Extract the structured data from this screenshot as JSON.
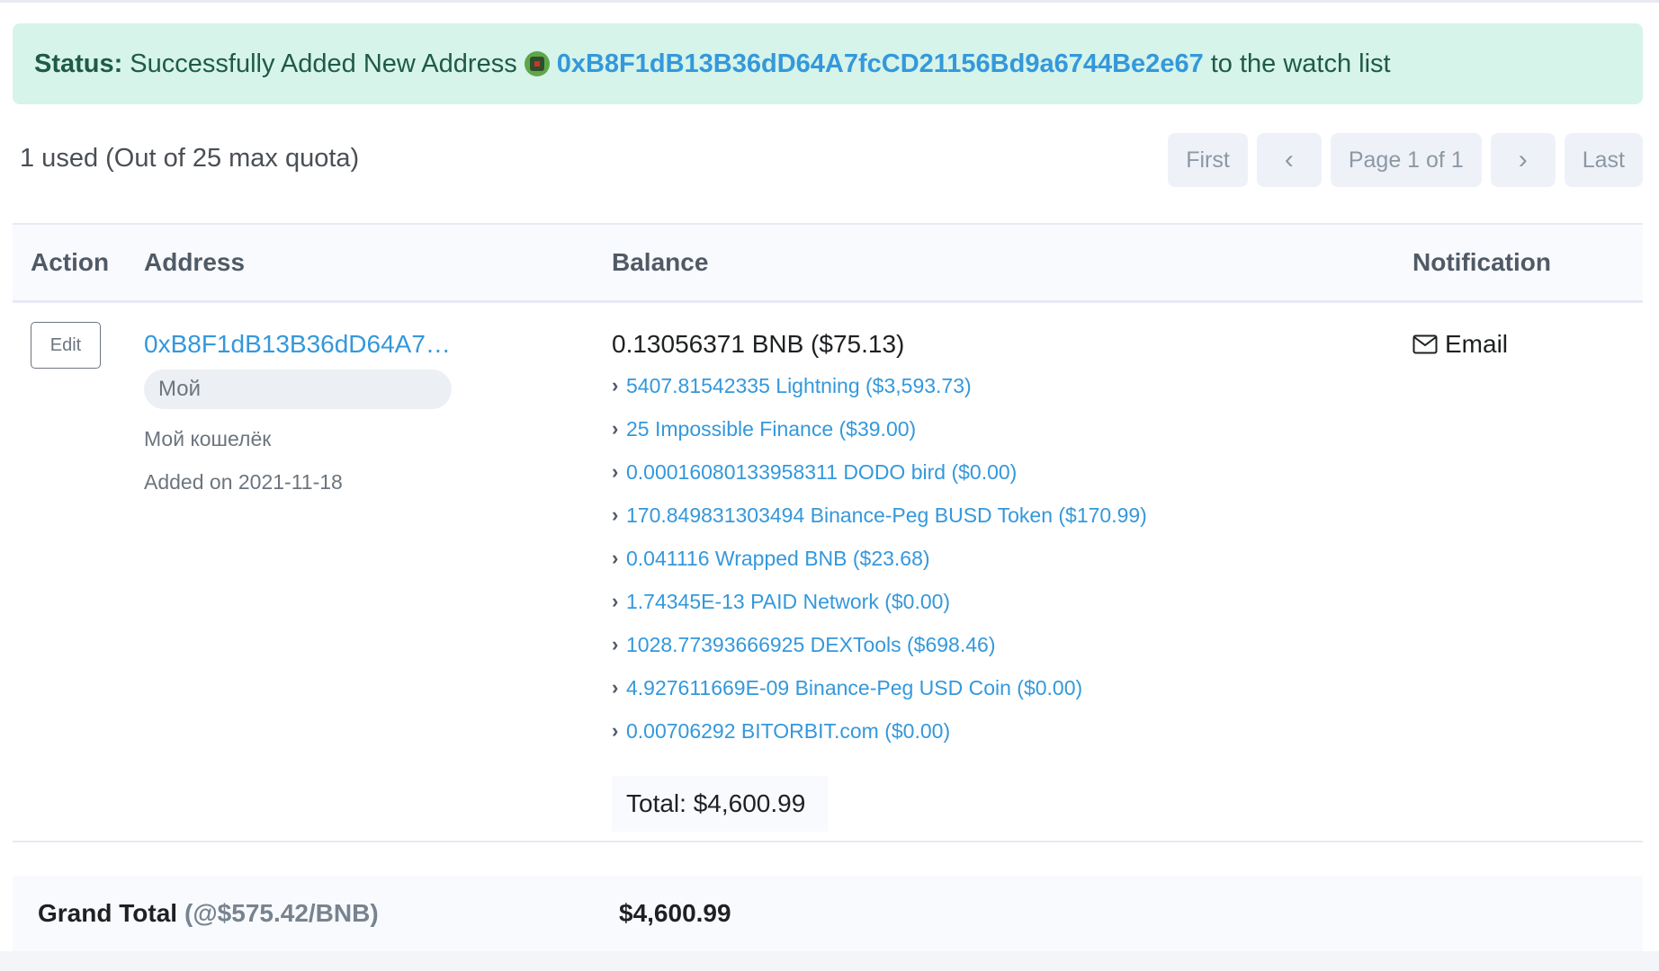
{
  "status": {
    "label": "Status:",
    "message_before": "Successfully Added New Address",
    "address": "0xB8F1dB13B36dD64A7fcCD21156Bd9a6744Be2e67",
    "message_after": "to the watch list"
  },
  "quota": {
    "text": "1 used (Out of 25 max quota)"
  },
  "pagination": {
    "first": "First",
    "prev": "‹",
    "page": "Page 1 of 1",
    "next": "›",
    "last": "Last"
  },
  "table": {
    "headers": {
      "action": "Action",
      "address": "Address",
      "balance": "Balance",
      "notification": "Notification"
    },
    "rows": [
      {
        "edit_label": "Edit",
        "address": "0xB8F1dB13B36dD64A7…",
        "tag": "Мой",
        "note": "Мой кошелёк",
        "added": "Added on 2021-11-18",
        "bnb_balance": "0.13056371 BNB ($75.13)",
        "tokens": [
          "5407.81542335 Lightning ($3,593.73)",
          "25 Impossible Finance ($39.00)",
          "0.00016080133958311 DODO bird ($0.00)",
          "170.849831303494 Binance-Peg BUSD Token ($170.99)",
          "0.041116 Wrapped BNB ($23.68)",
          "1.74345E-13 PAID Network ($0.00)",
          "1028.77393666925 DEXTools ($698.46)",
          "4.927611669E-09 Binance-Peg USD Coin ($0.00)",
          "0.00706292 BITORBIT.com ($0.00)"
        ],
        "total": "Total: $4,600.99",
        "notification": "Email"
      }
    ]
  },
  "grand_total": {
    "label": "Grand Total",
    "rate": "(@$575.42/BNB)",
    "value": "$4,600.99"
  },
  "colors": {
    "link": "#3498db",
    "alert_bg": "#d6f4ea",
    "alert_text": "#1f5a48"
  },
  "icons": {
    "status_avatar": "blockie-avatar-icon",
    "row_chevron": "chevron-right-icon",
    "notification": "envelope-icon"
  }
}
